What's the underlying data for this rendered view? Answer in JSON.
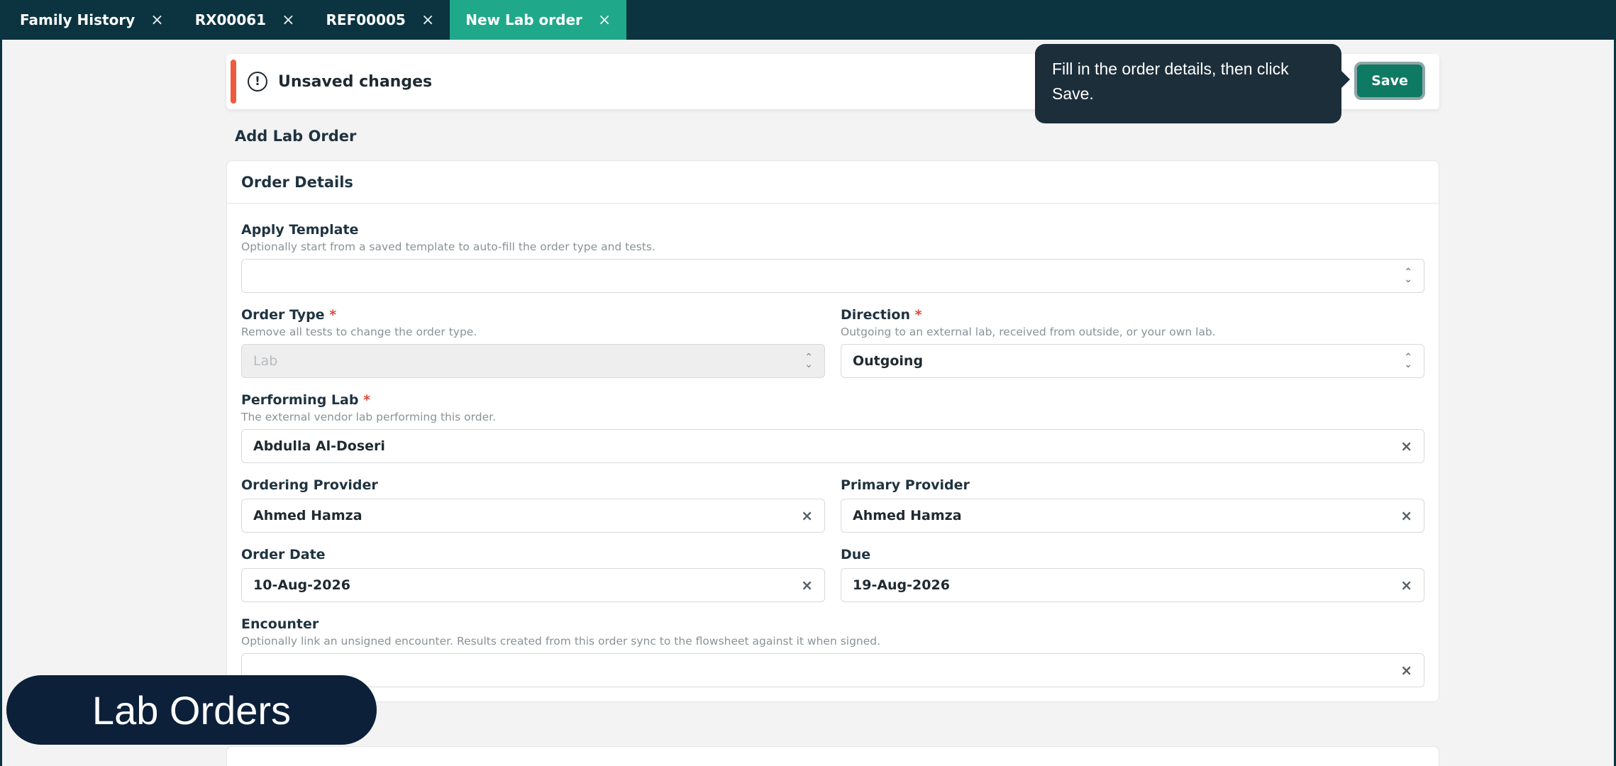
{
  "tabs": [
    {
      "label": "Family History",
      "active": false
    },
    {
      "label": "RX00061",
      "active": false
    },
    {
      "label": "REF00005",
      "active": false
    },
    {
      "label": "New Lab order",
      "active": true
    }
  ],
  "tab_close_glyph": "×",
  "banner": {
    "icon": "alert-circle-icon",
    "label": "Unsaved changes",
    "accent_color": "#ef5a3c",
    "save_label": "Save"
  },
  "tooltip": {
    "text": "Fill in the order details, then click Save."
  },
  "page_title": "Add Lab Order",
  "card": {
    "title": "Order Details",
    "fields": {
      "apply_template": {
        "label": "Apply Template",
        "help": "Optionally start from a saved template to auto-fill the order type and tests.",
        "value": ""
      },
      "order_type": {
        "label": "Order Type",
        "required": "*",
        "help": "Remove all tests to change the order type.",
        "value": "Lab"
      },
      "direction": {
        "label": "Direction",
        "required": "*",
        "help": "Outgoing to an external lab, received from outside, or your own lab.",
        "value": "Outgoing"
      },
      "performing_lab": {
        "label": "Performing Lab",
        "required": "*",
        "help": "The external vendor lab performing this order.",
        "value": "Abdulla Al-Doseri"
      },
      "ordering_provider": {
        "label": "Ordering Provider",
        "value": "Ahmed Hamza"
      },
      "primary_provider": {
        "label": "Primary Provider",
        "value": "Ahmed Hamza"
      },
      "order_date": {
        "label": "Order Date",
        "value": "10-Aug-2026"
      },
      "due": {
        "label": "Due",
        "value": "19-Aug-2026"
      },
      "encounter": {
        "label": "Encounter",
        "help": "Optionally link an unsigned encounter. Results created from this order sync to the flowsheet against it when signed.",
        "value": ""
      }
    }
  },
  "glyphs": {
    "clear": "×",
    "chev_up": "⌃",
    "chev_down": "⌄",
    "alert": "!"
  },
  "overlay_badge": {
    "label": "Lab Orders"
  },
  "colors": {
    "tabbar": "#0b3340",
    "active_tab": "#1fa98a",
    "save_button": "#0e7a63",
    "tooltip": "#1c2e3a",
    "badge": "#0c2039"
  }
}
